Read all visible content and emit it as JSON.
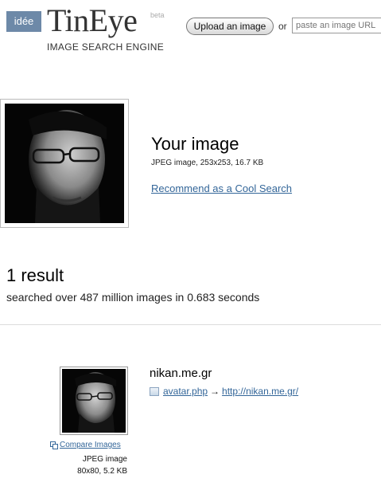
{
  "header": {
    "idee_label": "idée",
    "brand": "TinEye",
    "beta": "beta",
    "tagline": "IMAGE SEARCH ENGINE",
    "upload_button": "Upload an image",
    "or_label": "or",
    "url_placeholder": "paste an image URL"
  },
  "query": {
    "heading": "Your image",
    "meta": "JPEG image, 253x253, 16.7 KB",
    "recommend_link": "Recommend as a Cool Search"
  },
  "summary": {
    "count": "1 result",
    "stats": "searched over 487 million images in 0.683 seconds"
  },
  "results": [
    {
      "domain": "nikan.me.gr",
      "file_link": "avatar.php",
      "arrow": "→",
      "page_link": "http://nikan.me.gr/",
      "compare_label": "Compare Images",
      "type": "JPEG image",
      "dims": "80x80, 5.2 KB"
    }
  ],
  "colors": {
    "link": "#336699",
    "idee_bg": "#6d89a8"
  },
  "icons": [
    "compare-icon",
    "page-icon"
  ]
}
